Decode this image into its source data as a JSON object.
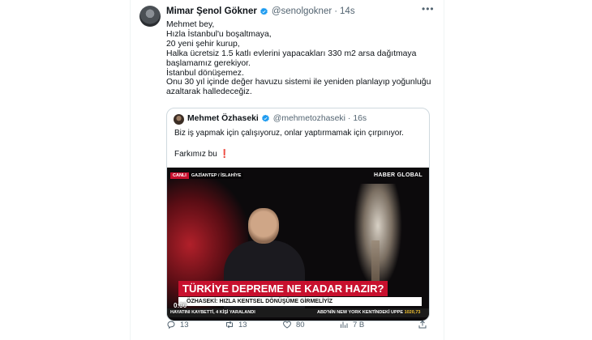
{
  "tweet": {
    "author_name": "Mimar Şenol Gökner",
    "handle": "@senolgokner",
    "separator": "·",
    "time": "14s",
    "lines": [
      "Mehmet bey,",
      "Hızla İstanbul'u boşaltmaya,",
      "20 yeni şehir kurup,",
      "Halka ücretsiz 1.5 katlı evlerini yapacakları 330 m2 arsa dağıtmaya",
      "başlamamız gerekiyor.",
      "İstanbul dönüşemez.",
      "Onu 30 yıl içinde değer havuzu sistemi ile yeniden planlayıp yoğunluğu",
      "azaltarak  halledeceğiz."
    ]
  },
  "quote": {
    "author_name": "Mehmet Özhaseki",
    "handle": "@mehmetozhaseki",
    "separator": "·",
    "time": "16s",
    "text1": "Biz iş yapmak için çalışıyoruz, onlar yaptırmamak için çırpınıyor.",
    "text2": "Farkımız bu",
    "emoji": "❗",
    "video": {
      "live_label": "CANLI",
      "location_label": "GAZİANTEP / İSLAHİYE",
      "channel": "HABER GLOBAL",
      "headline": "TÜRKİYE DEPREME NE KADAR HAZIR?",
      "subheadline": "ÖZHASEKİ: HIZLA KENTSEL DÖNÜŞÜME GİRMELİYİZ",
      "ticker_left": "HAYATINI KAYBETTİ, 4 KİŞİ YARALANDI",
      "ticker_right": "ABD'NİN NEW YORK KENTİNDEKİ UPPE",
      "ticker_value": "1020,73",
      "timecode": "0:36"
    }
  },
  "actions": {
    "replies": "13",
    "retweets": "13",
    "likes": "80",
    "views": "7 B"
  },
  "colors": {
    "text": "#0f1419",
    "secondary": "#536471",
    "verified": "#1d9bf0",
    "border": "#cfd9de",
    "news_red": "#c8102e"
  }
}
